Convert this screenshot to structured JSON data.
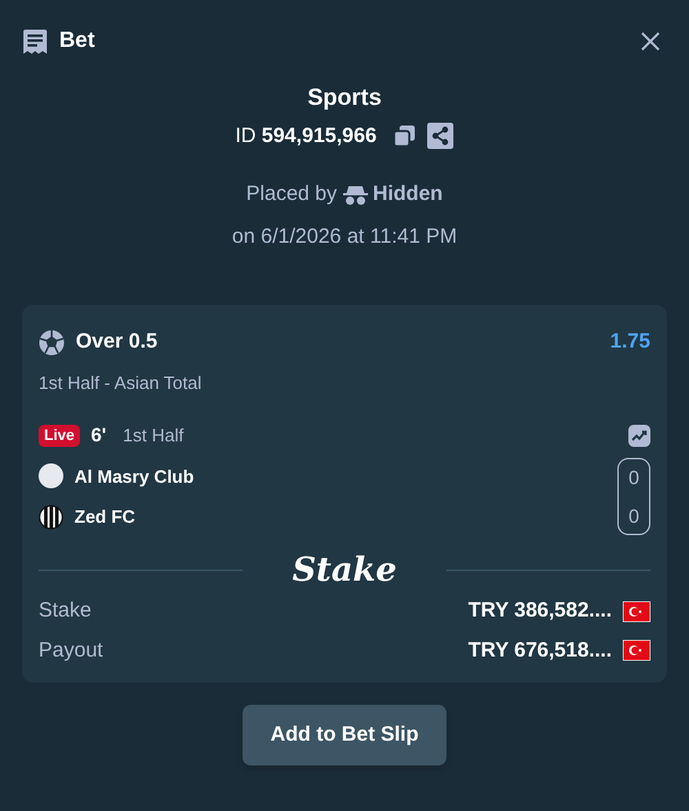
{
  "header": {
    "title": "Bet"
  },
  "summary": {
    "category": "Sports",
    "id_label": "ID",
    "id_value": "594,915,966",
    "placed_by_label": "Placed by",
    "placed_by_user": "Hidden",
    "placed_on": "on 6/1/2026 at 11:41 PM"
  },
  "selection": {
    "outcome": "Over 0.5",
    "odds": "1.75",
    "market": "1st Half - Asian Total",
    "live_badge": "Live",
    "minute": "6'",
    "period": "1st Half",
    "teams": [
      {
        "name": "Al Masry Club",
        "kind": "plain",
        "score": "0"
      },
      {
        "name": "Zed FC",
        "kind": "striped",
        "score": "0"
      }
    ]
  },
  "brand": "Stake",
  "amounts": [
    {
      "label": "Stake",
      "value": "TRY 386,582...."
    },
    {
      "label": "Payout",
      "value": "TRY 676,518...."
    }
  ],
  "action_button": "Add to Bet Slip"
}
